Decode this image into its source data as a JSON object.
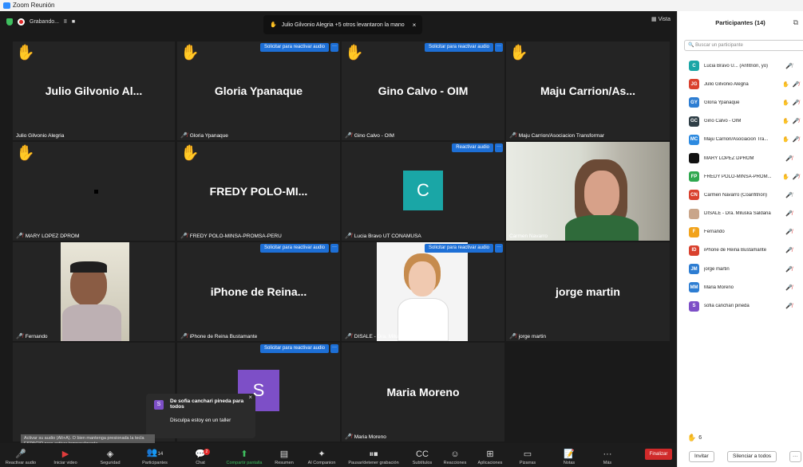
{
  "window": {
    "title": "Zoom Reunión"
  },
  "topbar": {
    "recording": "Grabando...",
    "pause_icon": "II",
    "stop_icon": "■",
    "view": "Vista"
  },
  "toast": {
    "text": "Julio Gilvonio Alegria +5 otros levantaron la mano",
    "close": "×"
  },
  "tiles": {
    "t1": {
      "name": "Julio Gilvonio Al...",
      "label": "Julio Gilvonio Alegria"
    },
    "t2": {
      "name": "Gloria Ypanaque",
      "label": "Gloria Ypanaque",
      "request": "Solicitar para reactivar audio"
    },
    "t3": {
      "name": "Gino Calvo - OIM",
      "label": "Gino Calvo - OIM",
      "request": "Solicitar para reactivar audio"
    },
    "t4": {
      "name": "Maju Carrion/As...",
      "label": "Maju Carrion/Asociacion Transformar"
    },
    "t5": {
      "label": "MARY LOPEZ DPROM"
    },
    "t6": {
      "name": "FREDY POLO-MI...",
      "label": "FREDY POLO-MINSA-PROMSA-PERU"
    },
    "t7": {
      "avatar": "C",
      "label": "Lucia Bravo UT CONAMUSA",
      "request": "Reactivar audio"
    },
    "t8": {
      "label": "Carmen Navarro"
    },
    "t9": {
      "label": "Fernando"
    },
    "t10": {
      "name": "iPhone de Reina...",
      "label": "iPhone de Reina Bustamante",
      "request": "Solicitar para reactivar audio"
    },
    "t11": {
      "label": "DISALE - Dra. Miluska Saldaña",
      "request": "Solicitar para reactivar audio"
    },
    "t12": {
      "name": "jorge martin",
      "label": "jorge martin"
    },
    "t14": {
      "avatar": "S",
      "request": "Solicitar para reactivar audio"
    },
    "t15": {
      "name": "Maria Moreno",
      "label": "Maria Moreno"
    }
  },
  "chat_popup": {
    "avatar": "S",
    "title": "De sofia canchari pineda para todos",
    "message": "Disculpa estoy en un taller",
    "close": "×"
  },
  "tooltip": "Activar su audio (Alt+A). O bien mantenga presionada la tecla ESPACIO para activar temporalmente",
  "toolbar": {
    "unmute": "Reactivar audio",
    "video": "Iniciar video",
    "security": "Seguridad",
    "participants": "Participantes",
    "participants_count": "14",
    "chat": "Chat",
    "chat_badge": "2",
    "share": "Compartir pantalla",
    "summary": "Resumen",
    "ai": "AI Companion",
    "record": "Pausar/detener grabación",
    "captions": "Subtítulos",
    "reactions": "Reacciones",
    "apps": "Aplicaciones",
    "whiteboards": "Pizarras",
    "notes": "Notas",
    "more": "Más",
    "finish": "Finalizar"
  },
  "panel": {
    "title": "Participantes (14)",
    "search_placeholder": "Buscar un participante",
    "participants": [
      {
        "initials": "C",
        "name": "Lucia Bravo U... (Anfitrión, yo)",
        "color": "#1aa6a6"
      },
      {
        "initials": "JG",
        "name": "Julio Gilvonio Alegria",
        "color": "#d9412e"
      },
      {
        "initials": "GY",
        "name": "Gloria Ypanaque",
        "color": "#2d7dd2"
      },
      {
        "initials": "GC",
        "name": "Gino Calvo - OIM",
        "color": "#2f3e46"
      },
      {
        "initials": "MC",
        "name": "Maju Carrion/Asociacion Tra...",
        "color": "#2d8ae0"
      },
      {
        "initials": "",
        "name": "MARY LOPEZ DPROM",
        "color": "#111111"
      },
      {
        "initials": "FP",
        "name": "FREDY POLO-MINSA-PROM...",
        "color": "#2fa84f"
      },
      {
        "initials": "CN",
        "name": "Carmen Navarro (Coanfitrión)",
        "color": "#d9412e"
      },
      {
        "initials": "",
        "name": "DISALE - Dra. Miluska Saldaña",
        "color": "#c9a58a"
      },
      {
        "initials": "F",
        "name": "Fernando",
        "color": "#f2a31b"
      },
      {
        "initials": "ID",
        "name": "iPhone de Reina Bustamante",
        "color": "#d9412e"
      },
      {
        "initials": "JM",
        "name": "jorge martin",
        "color": "#2d7dd2"
      },
      {
        "initials": "MM",
        "name": "Maria Moreno",
        "color": "#2d7dd2"
      },
      {
        "initials": "S",
        "name": "sofia canchari pineda",
        "color": "#7d4fc7"
      }
    ],
    "hands_count": "6",
    "invite": "Invitar",
    "mute_all": "Silenciar a todos",
    "more": "···"
  }
}
